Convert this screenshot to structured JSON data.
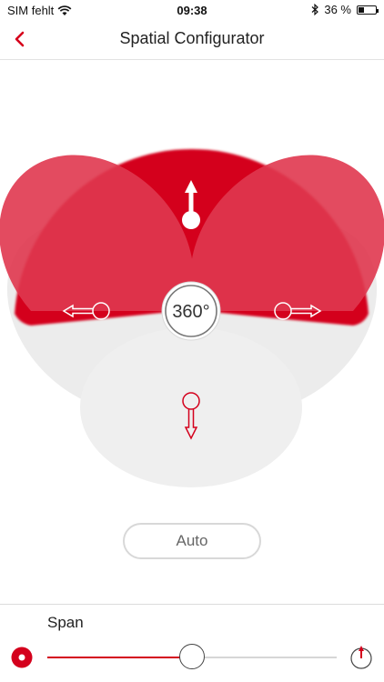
{
  "status_bar": {
    "carrier": "SIM fehlt",
    "time": "09:38",
    "battery_text": "36 %",
    "battery_level": 0.36
  },
  "nav": {
    "title": "Spatial Configurator",
    "back_icon": "chevron-left-icon"
  },
  "configurator": {
    "center_label": "360°",
    "directions": [
      "up",
      "left",
      "right",
      "down"
    ],
    "accent_color": "#d6001c"
  },
  "auto_button": {
    "label": "Auto"
  },
  "span": {
    "label": "Span",
    "value": 0.5,
    "min_icon": "record-dot-icon",
    "max_icon": "arrow-circle-icon"
  },
  "colors": {
    "accent": "#d6001c",
    "inactive_lobe": "#e9e9e9"
  }
}
